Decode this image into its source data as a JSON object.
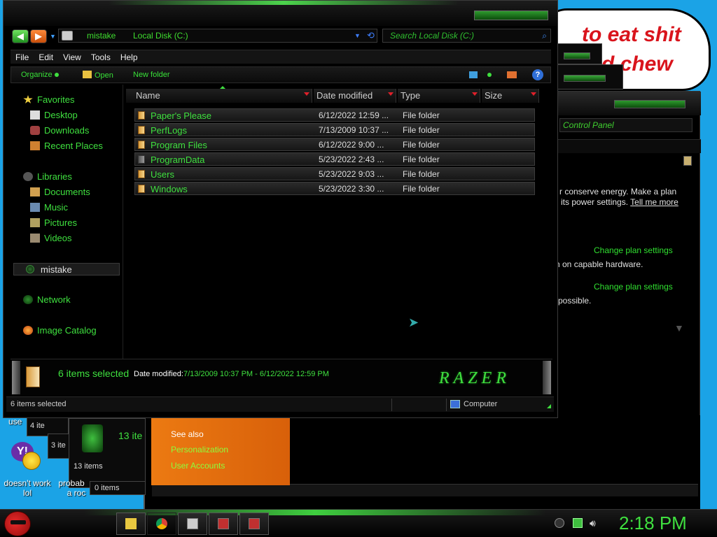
{
  "background_bubble": {
    "line1": "to eat shit",
    "line2": "d chew"
  },
  "control_panel": {
    "search_placeholder": "Control Panel",
    "text_line1": "r conserve energy. Make a plan",
    "text_line2": "its power settings.",
    "tell_me_more": "Tell me more",
    "link1": "Change plan settings",
    "text_line3": "n on capable hardware.",
    "link2": "Change plan settings",
    "text_line4": "possible."
  },
  "bg_windows": {
    "items_4": "4 ite",
    "items_3": "3 ite",
    "items_13_big": "13 ite",
    "items_13": "13 items",
    "items_0": "0 items",
    "use_label": "use"
  },
  "orange_panel": {
    "see_also": "See also",
    "link1": "Personalization",
    "link2": "User Accounts"
  },
  "desktop": {
    "yahoo_label_line1": "doesn't work",
    "yahoo_label_line2": "lol",
    "other_label_line1": "probab",
    "other_label_line2": "a roc"
  },
  "explorer": {
    "address": {
      "segment1": "mistake",
      "segment2": "Local Disk (C:)"
    },
    "search_placeholder": "Search Local Disk (C:)",
    "menu": [
      "File",
      "Edit",
      "View",
      "Tools",
      "Help"
    ],
    "toolbar": {
      "organize": "Organize",
      "open": "Open",
      "new_folder": "New folder"
    },
    "sidebar": {
      "favorites": "Favorites",
      "desktop": "Desktop",
      "downloads": "Downloads",
      "recent_places": "Recent Places",
      "libraries": "Libraries",
      "documents": "Documents",
      "music": "Music",
      "pictures": "Pictures",
      "videos": "Videos",
      "homegroup": "mistake",
      "network": "Network",
      "image_catalog": "Image Catalog"
    },
    "columns": {
      "name": "Name",
      "date": "Date modified",
      "type": "Type",
      "size": "Size"
    },
    "files": [
      {
        "name": "Paper's Please",
        "date": "6/12/2022 12:59 ...",
        "type": "File folder"
      },
      {
        "name": "PerfLogs",
        "date": "7/13/2009 10:37 ...",
        "type": "File folder"
      },
      {
        "name": "Program Files",
        "date": "6/12/2022 9:00 ...",
        "type": "File folder"
      },
      {
        "name": "ProgramData",
        "date": "5/23/2022 2:43 ...",
        "type": "File folder"
      },
      {
        "name": "Users",
        "date": "5/23/2022 9:03 ...",
        "type": "File folder"
      },
      {
        "name": "Windows",
        "date": "5/23/2022 3:30 ...",
        "type": "File folder"
      }
    ],
    "details": {
      "count": "6 items selected",
      "date_label": "Date modified:",
      "date_value": "7/13/2009 10:37 PM - 6/12/2022 12:59 PM",
      "brand": "RAZER"
    },
    "status": {
      "left": "6 items selected",
      "computer": "Computer"
    }
  },
  "taskbar": {
    "clock": "2:18 PM"
  },
  "colors": {
    "accent_green": "#3fe03f",
    "desktop_blue": "#1ba3e6",
    "orange": "#ec7a12"
  }
}
